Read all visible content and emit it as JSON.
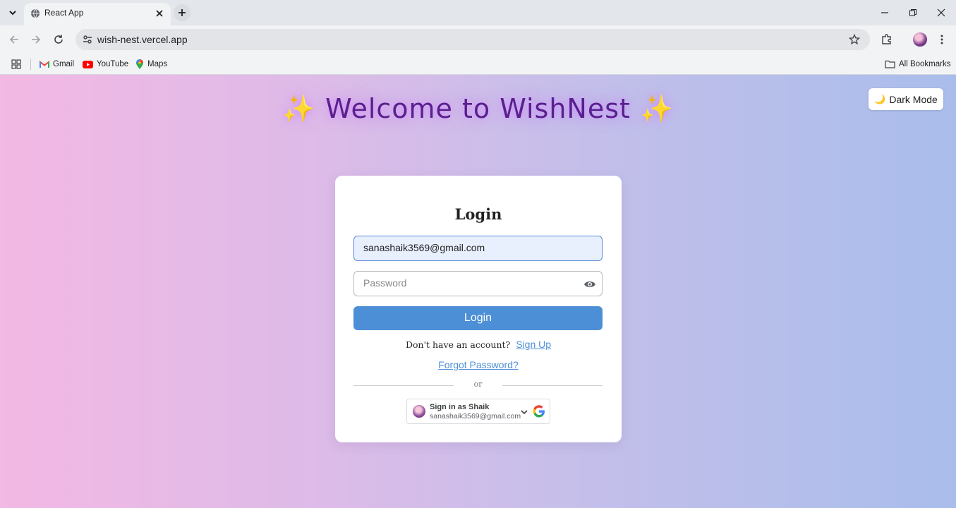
{
  "browser": {
    "tab_title": "React App",
    "url": "wish-nest.vercel.app",
    "bookmarks": [
      {
        "label": "Gmail",
        "icon": "gmail-icon"
      },
      {
        "label": "YouTube",
        "icon": "youtube-icon"
      },
      {
        "label": "Maps",
        "icon": "maps-icon"
      }
    ],
    "all_bookmarks_label": "All Bookmarks"
  },
  "page": {
    "heading_sparkle": "✨",
    "heading_text": "Welcome to WishNest",
    "dark_mode_icon": "🌙",
    "dark_mode_label": "Dark Mode"
  },
  "login": {
    "title": "Login",
    "email_value": "sanashaik3569@gmail.com",
    "password_placeholder": "Password",
    "submit_label": "Login",
    "no_account_text": "Don't have an account?",
    "signup_link": "Sign Up",
    "forgot_link": "Forgot Password?",
    "or_text": "or",
    "google": {
      "signin_label": "Sign in as Shaik",
      "email": "sanashaik3569@gmail.com"
    }
  },
  "colors": {
    "accent": "#4d8fd6",
    "heading": "#5b1f8f",
    "gradient_start": "#f3b8e4",
    "gradient_end": "#a9bdeb"
  }
}
